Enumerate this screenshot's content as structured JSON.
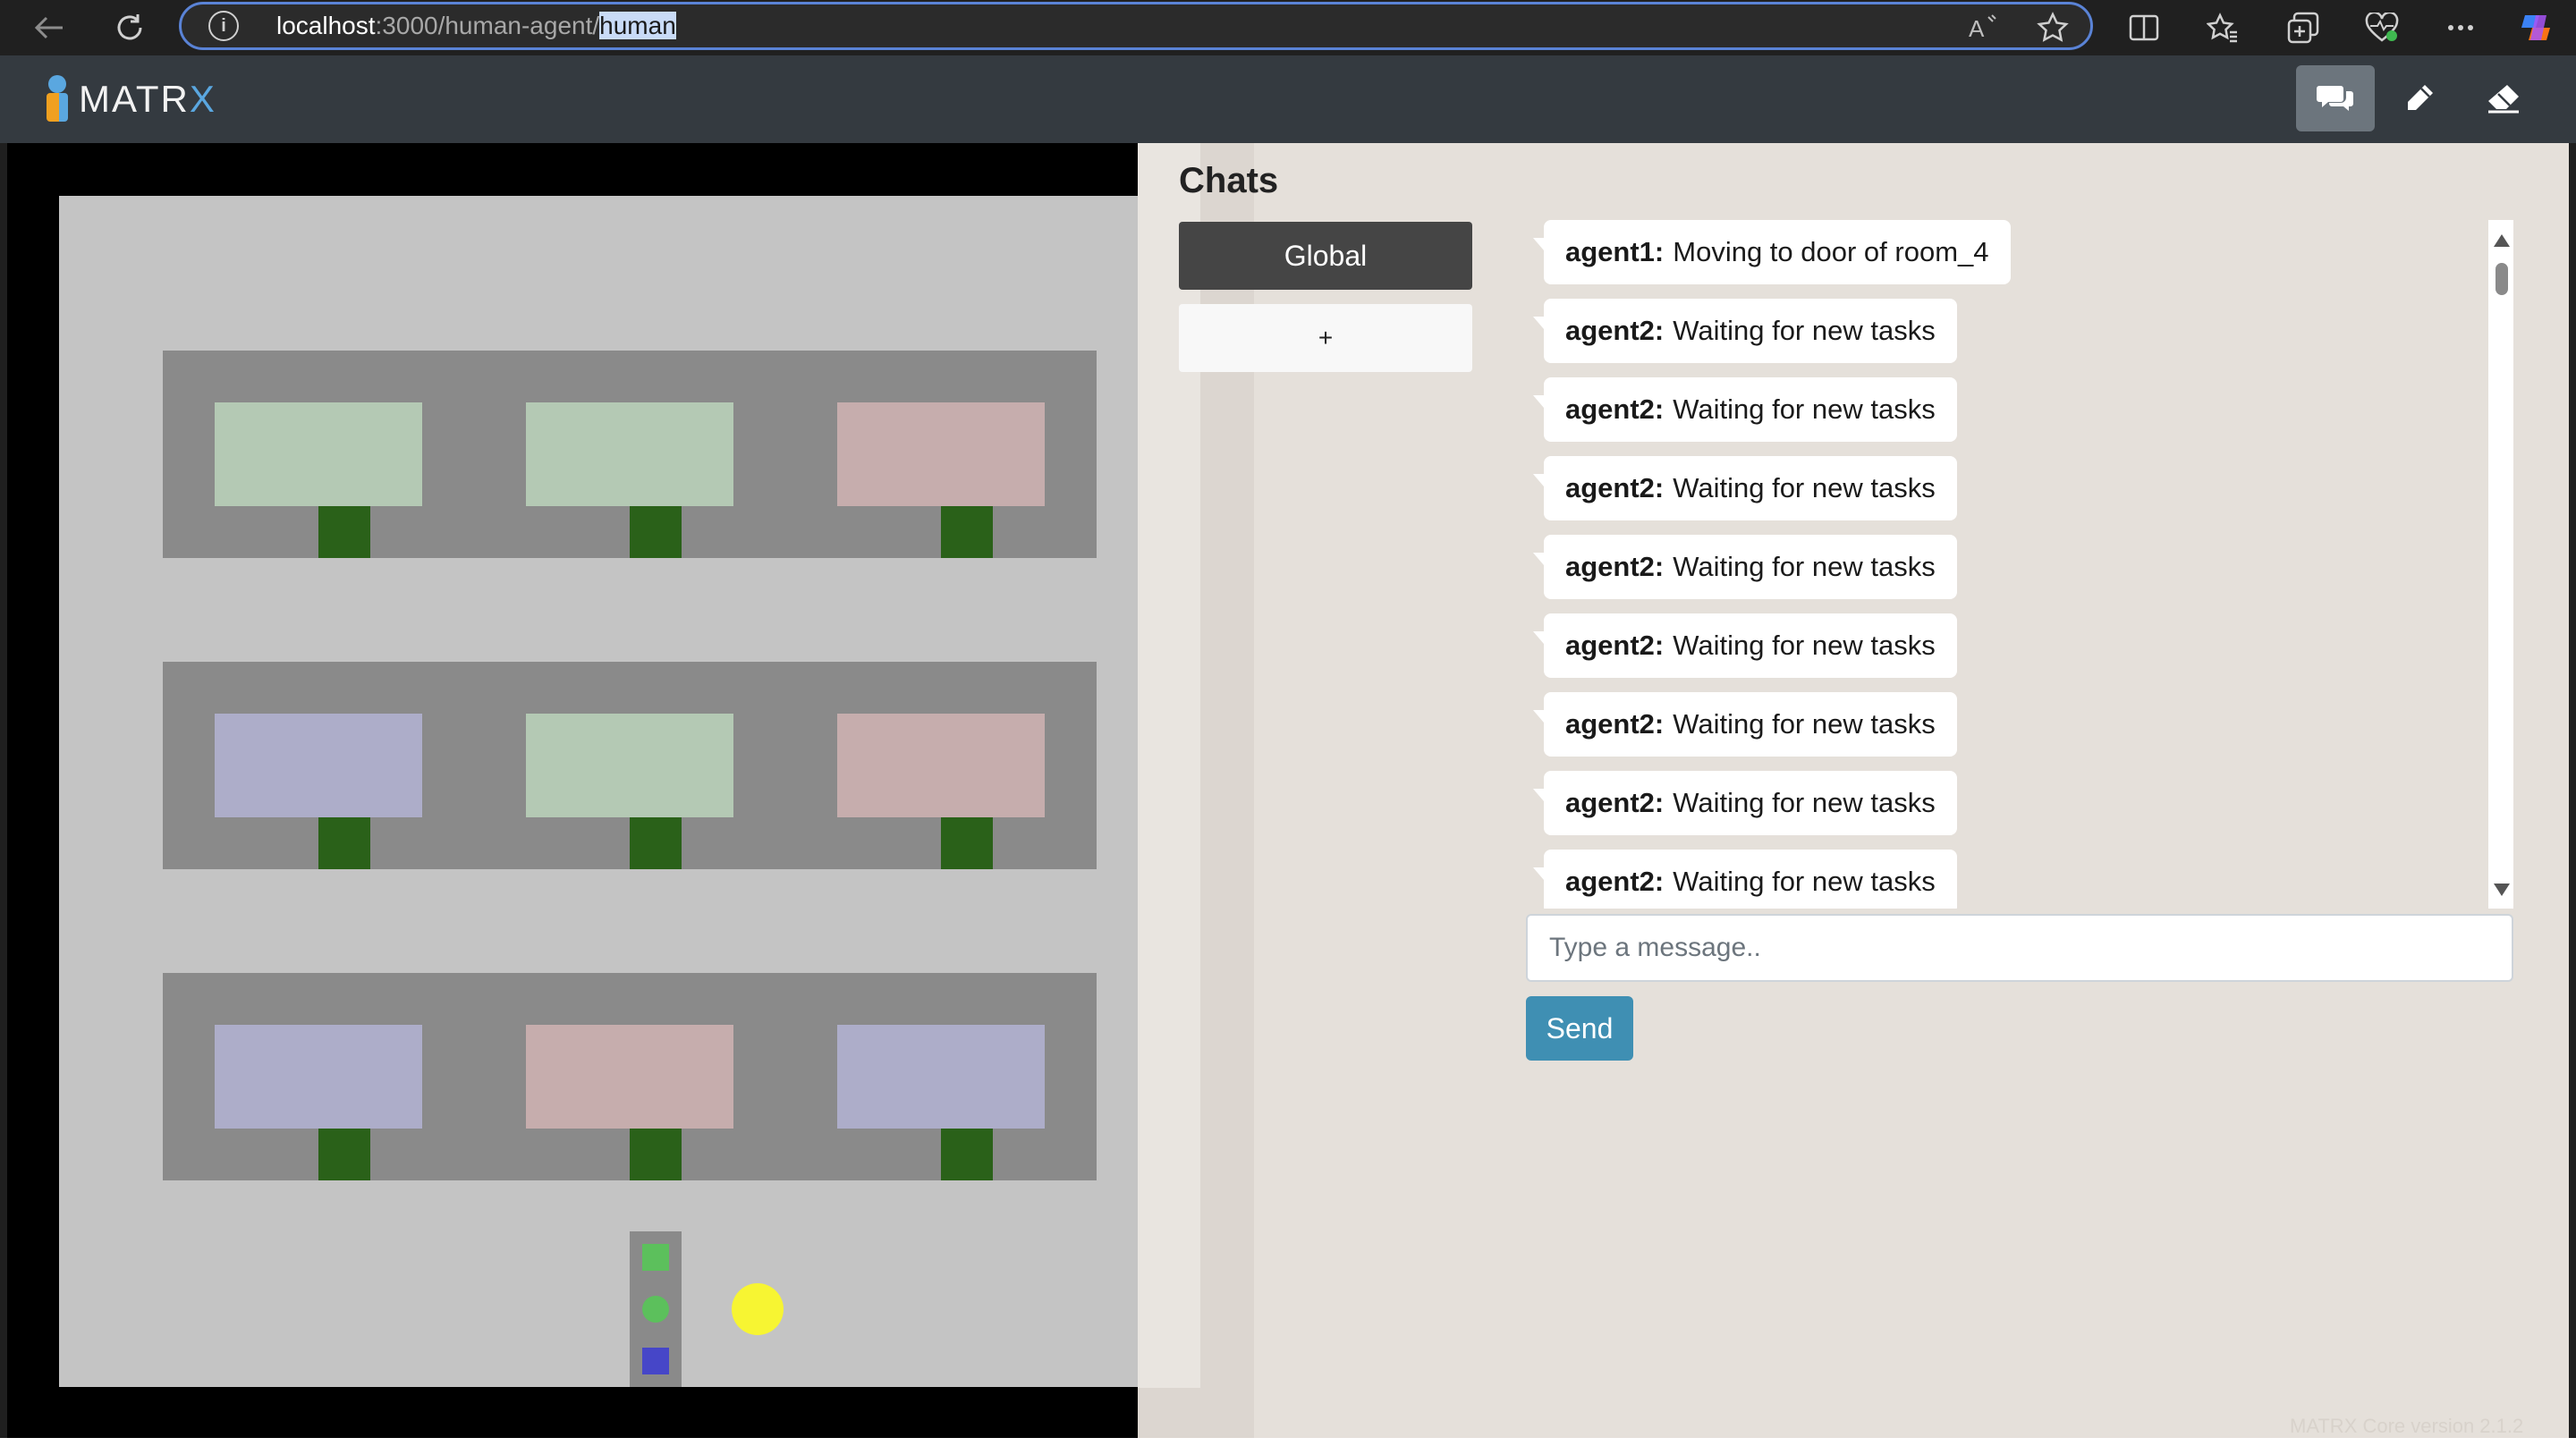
{
  "browser": {
    "url_host": "localhost",
    "url_port_path": ":3000/human-agent/",
    "url_selected": "human",
    "icons": [
      "back-arrow-icon",
      "reload-icon",
      "info-icon",
      "read-aloud-icon",
      "favorite-star-icon",
      "split-screen-icon",
      "favorites-icon",
      "collections-icon",
      "browser-essentials-icon",
      "more-icon",
      "copilot-icon"
    ]
  },
  "header": {
    "logo_main": "MATR",
    "logo_x": "X",
    "buttons": [
      "chat-icon",
      "pencil-icon",
      "eraser-icon"
    ]
  },
  "colors": {
    "header_bg": "#343a40",
    "world_bg": "#c4c4c4",
    "room_wall": "#8a8a8a",
    "door": "#2a6119",
    "tile_green": "#b4c9b4",
    "tile_blue": "#adadc9",
    "tile_red": "#c6adad",
    "agent_yellow": "#f7f532",
    "send_button": "#3f8fb3"
  },
  "world": {
    "rooms": [
      [
        "green",
        "green",
        "red"
      ],
      [
        "blue",
        "green",
        "red"
      ],
      [
        "blue",
        "red",
        "blue"
      ]
    ],
    "dropzone_items": [
      "green-square",
      "green-circle",
      "blue-square"
    ],
    "agent": "yellow-circle"
  },
  "chat": {
    "title": "Chats",
    "channels": [
      {
        "label": "Global"
      },
      {
        "label": "+"
      }
    ],
    "messages": [
      {
        "sender": "agent1:",
        "text": "Moving to door of room_4"
      },
      {
        "sender": "agent2:",
        "text": "Waiting for new tasks"
      },
      {
        "sender": "agent2:",
        "text": "Waiting for new tasks"
      },
      {
        "sender": "agent2:",
        "text": "Waiting for new tasks"
      },
      {
        "sender": "agent2:",
        "text": "Waiting for new tasks"
      },
      {
        "sender": "agent2:",
        "text": "Waiting for new tasks"
      },
      {
        "sender": "agent2:",
        "text": "Waiting for new tasks"
      },
      {
        "sender": "agent2:",
        "text": "Waiting for new tasks"
      },
      {
        "sender": "agent2:",
        "text": "Waiting for new tasks"
      }
    ],
    "input_placeholder": "Type a message..",
    "send_label": "Send"
  },
  "footer": {
    "version": "MATRX Core version 2.1.2"
  }
}
